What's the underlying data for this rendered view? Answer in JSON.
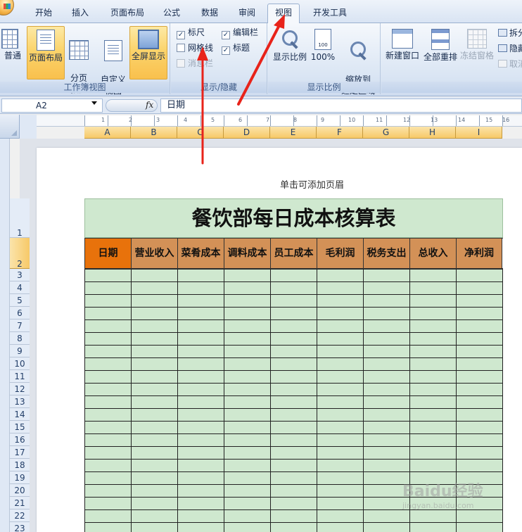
{
  "tabs": [
    "开始",
    "插入",
    "页面布局",
    "公式",
    "数据",
    "审阅",
    "视图",
    "开发工具"
  ],
  "active_tab": "视图",
  "ribbon": {
    "workbook_views": {
      "label": "工作簿视图",
      "buttons": [
        "普通",
        "页面布局",
        "分页\n预览",
        "自定义\n视图",
        "全屏显示"
      ]
    },
    "show_hide": {
      "label": "显示/隐藏",
      "ruler": "标尺",
      "gridlines": "网格线",
      "message_bar": "消息栏",
      "formula_bar": "编辑栏",
      "headings": "标题"
    },
    "zoom": {
      "label": "显示比例",
      "zoom_btn": "显示比例",
      "hundred_btn": "100%",
      "hundred_icon_text": "100",
      "zoom_sel_btn": "缩放到\n选定区域"
    },
    "window": {
      "new_window": "新建窗口",
      "arrange_all": "全部重排",
      "freeze_panes": "冻结窗格",
      "split": "拆分",
      "hide": "隐藏",
      "unhide": "取消"
    }
  },
  "formula_bar": {
    "name_box": "A2",
    "fx_label": "fx",
    "content": "日期"
  },
  "ruler_numbers": [
    "1",
    "2",
    "3",
    "4",
    "5",
    "6",
    "7",
    "8",
    "9",
    "10",
    "11",
    "12",
    "13",
    "14",
    "15",
    "16"
  ],
  "columns": [
    "A",
    "B",
    "C",
    "D",
    "E",
    "F",
    "G",
    "H",
    "I"
  ],
  "rows": [
    "1",
    "2",
    "3",
    "4",
    "5",
    "6",
    "7",
    "8",
    "9",
    "10",
    "11",
    "12",
    "13",
    "14",
    "15",
    "16",
    "17",
    "18",
    "19",
    "20",
    "21",
    "22",
    "23"
  ],
  "header_hint": "单击可添加页眉",
  "sheet": {
    "title": "餐饮部每日成本核算表",
    "headers": [
      "日期",
      "营业收入",
      "菜肴成本",
      "调料成本",
      "员工成本",
      "毛利润",
      "税务支出",
      "总收入",
      "净利润"
    ]
  },
  "colors": {
    "title_bg": "#cfe8cf",
    "header_bg": "#d39157",
    "active_header_bg": "#e8720b",
    "annotation_arrow": "#e8231a"
  },
  "watermark": {
    "brand": "Baidu经验",
    "url": "jingyan.baidu.com"
  }
}
